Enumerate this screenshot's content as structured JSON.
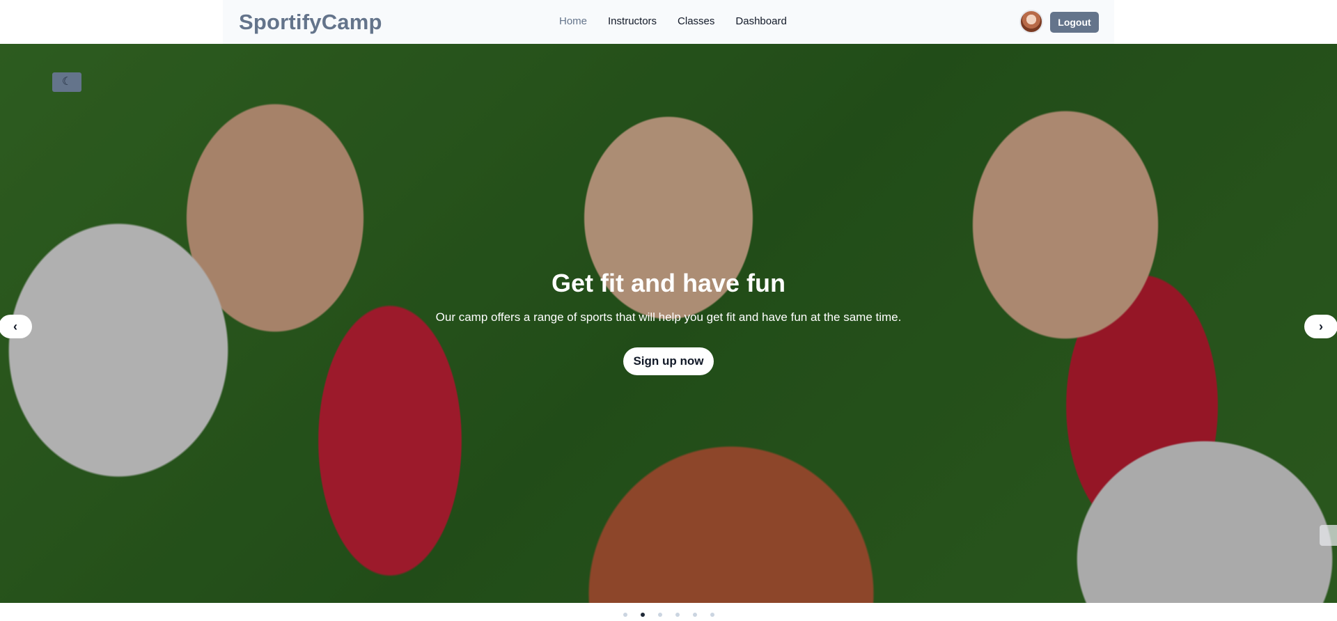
{
  "brand": "SportifyCamp",
  "nav": {
    "links": [
      {
        "label": "Home",
        "active": true
      },
      {
        "label": "Instructors"
      },
      {
        "label": "Classes"
      },
      {
        "label": "Dashboard"
      }
    ],
    "logout_label": "Logout"
  },
  "hero": {
    "title": "Get fit and have fun",
    "subtitle": "Our camp offers a range of sports that will help you get fit and have fun at the same time.",
    "cta_label": "Sign up now",
    "prev_icon": "chevron-left-icon",
    "next_icon": "chevron-right-icon",
    "theme_icon": "moon-icon"
  },
  "carousel": {
    "total_slides": 6,
    "active_index": 1
  },
  "colors": {
    "accent": "#64748b",
    "active_dot": "#1f2937",
    "inactive_dot": "#cbd5e1"
  }
}
